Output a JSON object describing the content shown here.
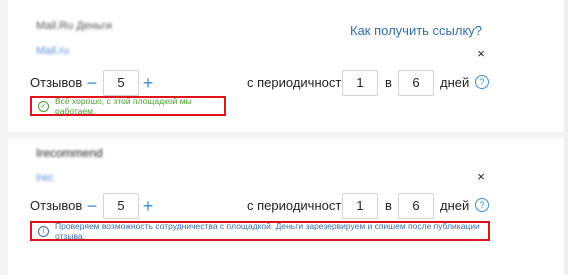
{
  "how_link": "Как получить ссылку?",
  "items": [
    {
      "name_blur": "Mail.Ru Деньги",
      "sub_blur": "Mail.ru",
      "reviews_label": "Отзывов",
      "minus": "−",
      "plus": "+",
      "count": "5",
      "period_label": "с периодичностью",
      "every": "1",
      "in_label": "в",
      "days": "6",
      "days_label": "дней",
      "help": "?",
      "close": "×",
      "notice_icon": "✓",
      "notice": "Всё хорошо, с этой площадкой мы работаем."
    },
    {
      "name_blur": "Irecommend",
      "sub_blur": "irec",
      "reviews_label": "Отзывов",
      "minus": "−",
      "plus": "+",
      "count": "5",
      "period_label": "с периодичностью",
      "every": "1",
      "in_label": "в",
      "days": "6",
      "days_label": "дней",
      "help": "?",
      "close": "×",
      "notice_icon": "i",
      "notice": "Проверяем возможность сотрудничества с площадкой. Деньги зарезервируем и спишем после публикации отзыва."
    }
  ]
}
